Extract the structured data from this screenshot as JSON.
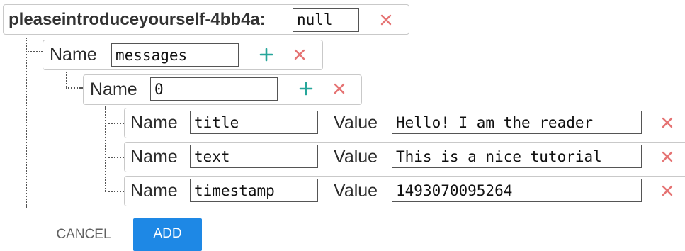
{
  "root": {
    "key": "pleaseintroduceyourself-4bb4a",
    "separator": ":",
    "value": "null"
  },
  "nodes": {
    "messages": {
      "name_label": "Name",
      "name_value": "messages"
    },
    "zero": {
      "name_label": "Name",
      "name_value": "0"
    }
  },
  "leaves": [
    {
      "name_label": "Name",
      "name_value": "title",
      "value_label": "Value",
      "value_value": "Hello! I am the reader"
    },
    {
      "name_label": "Name",
      "name_value": "text",
      "value_label": "Value",
      "value_value": "This is a nice tutorial"
    },
    {
      "name_label": "Name",
      "name_value": "timestamp",
      "value_label": "Value",
      "value_value": "1493070095264"
    }
  ],
  "actions": {
    "cancel_label": "CANCEL",
    "add_label": "ADD"
  },
  "colors": {
    "add_icon": "#26a69a",
    "remove_icon": "#e57373",
    "primary_button": "#1e88e5"
  },
  "icons": {
    "add": "plus-icon",
    "remove": "close-icon"
  }
}
